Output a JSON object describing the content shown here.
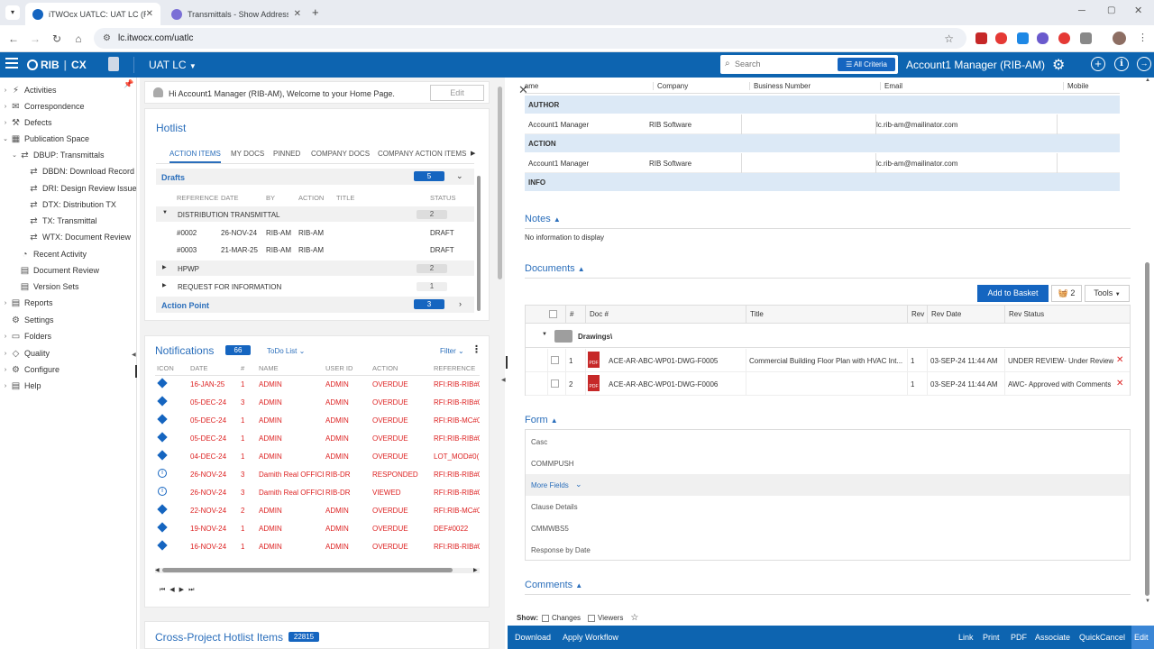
{
  "browser": {
    "tabs": [
      {
        "title": "iTWOcx UATLC: UAT LC (RIB-AM"
      },
      {
        "title": "Transmittals - Show Addressing"
      }
    ],
    "url": "lc.itwocx.com/uatlc"
  },
  "app": {
    "logo": "RIB",
    "product": "CX",
    "project": "UAT LC",
    "search_placeholder": "Search",
    "all_criteria": "All Criteria",
    "user": "Account1 Manager (RIB-AM)"
  },
  "nav": {
    "items": [
      {
        "label": "Activities"
      },
      {
        "label": "Correspondence"
      },
      {
        "label": "Defects"
      },
      {
        "label": "Publication Space"
      },
      {
        "label": "DBUP: Transmittals"
      },
      {
        "label": "DBDN: Download Record"
      },
      {
        "label": "DRI: Design Review Issue"
      },
      {
        "label": "DTX: Distribution TX"
      },
      {
        "label": "TX: Transmittal"
      },
      {
        "label": "WTX: Document Review"
      },
      {
        "label": "Recent Activity"
      },
      {
        "label": "Document Review"
      },
      {
        "label": "Version Sets"
      },
      {
        "label": "Reports"
      },
      {
        "label": "Settings"
      },
      {
        "label": "Folders"
      },
      {
        "label": "Quality"
      },
      {
        "label": "Configure"
      },
      {
        "label": "Help"
      }
    ]
  },
  "welcome": {
    "text": "Hi Account1 Manager (RIB-AM), Welcome to your Home Page.",
    "edit": "Edit"
  },
  "hotlist": {
    "title": "Hotlist",
    "tabs": [
      "ACTION ITEMS",
      "MY DOCS",
      "PINNED",
      "COMPANY DOCS",
      "COMPANY ACTION ITEMS"
    ],
    "drafts_label": "Drafts",
    "drafts_count": "5",
    "columns": [
      "REFERENCE",
      "DATE",
      "BY",
      "ACTION",
      "TITLE",
      "STATUS"
    ],
    "group1": "DISTRIBUTION TRANSMITTAL",
    "group1_count": "2",
    "rows": [
      {
        "ref": "#0002",
        "date": "26-NOV-24",
        "by": "RIB-AM",
        "action": "RIB-AM",
        "status": "DRAFT"
      },
      {
        "ref": "#0003",
        "date": "21-MAR-25",
        "by": "RIB-AM",
        "action": "RIB-AM",
        "status": "DRAFT"
      }
    ],
    "group2": "HPWP",
    "group2_count": "2",
    "group3": "REQUEST FOR INFORMATION",
    "group3_count": "1",
    "action_point": "Action Point",
    "action_point_count": "3"
  },
  "notifications": {
    "title": "Notifications",
    "count": "66",
    "todo": "ToDo List",
    "filter": "Filter",
    "columns": [
      "ICON",
      "DATE",
      "#",
      "NAME",
      "USER ID",
      "ACTION",
      "REFERENCE"
    ],
    "rows": [
      {
        "date": "16-JAN-25",
        "num": "1",
        "name": "ADMIN",
        "user": "ADMIN",
        "action": "OVERDUE",
        "ref": "RFI:RIB-RIB#0(",
        "icon": "diamond"
      },
      {
        "date": "05-DEC-24",
        "num": "3",
        "name": "ADMIN",
        "user": "ADMIN",
        "action": "OVERDUE",
        "ref": "RFI:RIB-RIB#0(",
        "icon": "diamond"
      },
      {
        "date": "05-DEC-24",
        "num": "1",
        "name": "ADMIN",
        "user": "ADMIN",
        "action": "OVERDUE",
        "ref": "RFI:RIB-MC#0(",
        "icon": "diamond"
      },
      {
        "date": "05-DEC-24",
        "num": "1",
        "name": "ADMIN",
        "user": "ADMIN",
        "action": "OVERDUE",
        "ref": "RFI:RIB-RIB#0(",
        "icon": "diamond"
      },
      {
        "date": "04-DEC-24",
        "num": "1",
        "name": "ADMIN",
        "user": "ADMIN",
        "action": "OVERDUE",
        "ref": "LOT_MOD#0(",
        "icon": "diamond"
      },
      {
        "date": "26-NOV-24",
        "num": "3",
        "name": "Damith Real OFFICE",
        "user": "RIB-DR",
        "action": "RESPONDED",
        "ref": "RFI:RIB-RIB#0(",
        "icon": "info"
      },
      {
        "date": "26-NOV-24",
        "num": "3",
        "name": "Damith Real OFFICE",
        "user": "RIB-DR",
        "action": "VIEWED",
        "ref": "RFI:RIB-RIB#0(",
        "icon": "info"
      },
      {
        "date": "22-NOV-24",
        "num": "2",
        "name": "ADMIN",
        "user": "ADMIN",
        "action": "OVERDUE",
        "ref": "RFI:RIB-MC#0(",
        "icon": "diamond"
      },
      {
        "date": "19-NOV-24",
        "num": "1",
        "name": "ADMIN",
        "user": "ADMIN",
        "action": "OVERDUE",
        "ref": "DEF#0022",
        "icon": "diamond"
      },
      {
        "date": "16-NOV-24",
        "num": "1",
        "name": "ADMIN",
        "user": "ADMIN",
        "action": "OVERDUE",
        "ref": "RFI:RIB-RIB#0(",
        "icon": "diamond"
      }
    ]
  },
  "crossproject": {
    "title": "Cross-Project Hotlist Items",
    "count": "22815"
  },
  "addressing": {
    "columns": [
      "Name",
      "Company",
      "Business Number",
      "Email",
      "Mobile"
    ],
    "author_label": "AUTHOR",
    "action_label": "ACTION",
    "info_label": "INFO",
    "author_row": {
      "name": "Account1 Manager",
      "company": "RIB Software",
      "email": "lc.rib-am@mailinator.com"
    },
    "action_row": {
      "name": "Account1 Manager",
      "company": "RIB Software",
      "email": "lc.rib-am@mailinator.com"
    }
  },
  "notes": {
    "title": "Notes",
    "empty": "No information to display"
  },
  "documents": {
    "title": "Documents",
    "add_basket": "Add to Basket",
    "basket_count": "2",
    "tools": "Tools",
    "columns": [
      "#",
      "Doc #",
      "Title",
      "Rev",
      "Rev Date",
      "Rev Status"
    ],
    "folder": "Drawings\\",
    "rows": [
      {
        "num": "1",
        "doc": "ACE-AR-ABC-WP01-DWG-F0005",
        "title": "Commercial Building Floor Plan with HVAC Int...",
        "rev": "1",
        "date": "03-SEP-24 11:44 AM",
        "status": "UNDER REVIEW- Under Review"
      },
      {
        "num": "2",
        "doc": "ACE-AR-ABC-WP01-DWG-F0006",
        "title": "",
        "rev": "1",
        "date": "03-SEP-24 11:44 AM",
        "status": "AWC- Approved with Comments"
      }
    ]
  },
  "form": {
    "title": "Form",
    "fields": [
      "Casc",
      "COMMPUSH"
    ],
    "more_fields": "More Fields",
    "extra": [
      "Clause Details",
      "CMMWBS5",
      "Response by Date"
    ]
  },
  "comments": {
    "title": "Comments"
  },
  "show": {
    "label": "Show:",
    "changes": "Changes",
    "viewers": "Viewers"
  },
  "bottombar": {
    "download": "Download",
    "apply": "Apply Workflow",
    "link": "Link",
    "print": "Print",
    "pdf": "PDF",
    "associate": "Associate",
    "quickcancel": "QuickCancel",
    "edit": "Edit"
  },
  "colors": {
    "brand": "#0d64b0",
    "accent": "#1565c0",
    "red": "#dd2222"
  }
}
